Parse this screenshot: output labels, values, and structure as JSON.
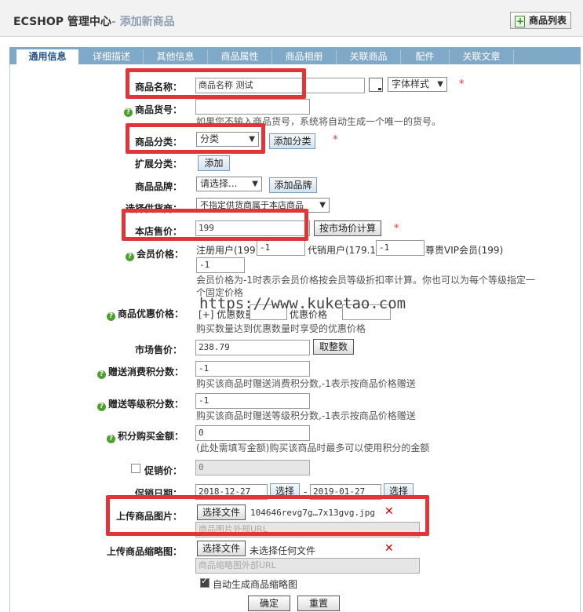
{
  "header": {
    "title": "ECSHOP 管理中心",
    "subtitle": "- 添加新商品",
    "list_button": "商品列表"
  },
  "tabs": [
    "通用信息",
    "详细描述",
    "其他信息",
    "商品属性",
    "商品相册",
    "关联商品",
    "配件",
    "关联文章"
  ],
  "form": {
    "goods_name": {
      "label": "商品名称：",
      "value": "商品名称 测试",
      "style_select": "字体样式",
      "required": "*"
    },
    "goods_sn": {
      "label": "商品货号：",
      "value": "",
      "note": "如果您不输入商品货号，系统将自动生成一个唯一的货号。"
    },
    "category": {
      "label": "商品分类：",
      "selected": "分类",
      "add_button": "添加分类",
      "required": "*"
    },
    "ext_category": {
      "label": "扩展分类：",
      "add_button": "添加"
    },
    "brand": {
      "label": "商品品牌：",
      "selected": "请选择...",
      "add_button": "添加品牌"
    },
    "supplier": {
      "label": "选择供货商：",
      "selected": "不指定供货商属于本店商品"
    },
    "shop_price": {
      "label": "本店售价：",
      "value": "199",
      "calc_button": "按市场价计算",
      "required": "*"
    },
    "member_price": {
      "label": "会员价格：",
      "registered_label": "注册用户(199)",
      "registered_value": "-1",
      "agent_label": "代销用户(179.1)",
      "agent_value": "-1",
      "vip_label": "尊贵VIP会员(199)",
      "vip_value": "-1",
      "note": "会员价格为-1时表示会员价格按会员等级折扣率计算。你也可以为每个等级指定一个固定价格"
    },
    "volume_price": {
      "label": "商品优惠价格：",
      "qty_label": "[+] 优惠数量",
      "price_label": "优惠价格",
      "note": "购买数量达到优惠数量时享受的优惠价格"
    },
    "market_price": {
      "label": "市场售价：",
      "value": "238.79",
      "round_button": "取整数"
    },
    "give_integral": {
      "label": "赠送消费积分数：",
      "value": "-1",
      "note": "购买该商品时赠送消费积分数,-1表示按商品价格赠送"
    },
    "rank_integral": {
      "label": "赠送等级积分数：",
      "value": "-1",
      "note": "购买该商品时赠送等级积分数,-1表示按商品价格赠送"
    },
    "integral": {
      "label": "积分购买金额：",
      "value": "0",
      "note": "(此处需填写金额)购买该商品时最多可以使用积分的金额"
    },
    "promote": {
      "label": "促销价：",
      "value": "0"
    },
    "promote_date": {
      "label": "促销日期：",
      "start": "2018-12-27",
      "end": "2019-01-27",
      "select_button": "选择",
      "dash": "-"
    },
    "goods_img": {
      "label": "上传商品图片：",
      "button": "选择文件",
      "filename": "104646revg7g…7x13gvg.jpg",
      "url_placeholder": "商品图片外部URL"
    },
    "goods_thumb": {
      "label": "上传商品缩略图：",
      "button": "选择文件",
      "filename": "未选择任何文件",
      "url_placeholder": "商品缩略图外部URL",
      "auto_label": "自动生成商品缩略图"
    }
  },
  "actions": {
    "submit": "确定",
    "reset": "重置"
  },
  "watermark": "https://www.kuketao.com",
  "colors": {
    "accent_red": "#e2353a",
    "tab_bg": "#7fa9c6",
    "help_green": "#4ca12e"
  }
}
